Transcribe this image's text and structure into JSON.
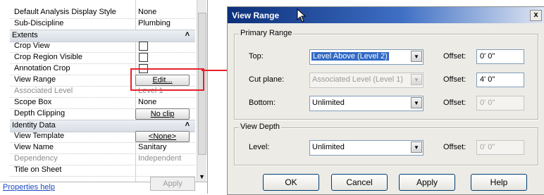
{
  "properties": {
    "rows_top": [
      {
        "label": "Default Analysis Display Style",
        "value": "None"
      },
      {
        "label": "Sub-Discipline",
        "value": "Plumbing"
      }
    ],
    "group_extents": {
      "label": "Extents",
      "collapse_icon": "chevrons-up-icon"
    },
    "extents_rows": [
      {
        "label": "Crop View",
        "checked": false
      },
      {
        "label": "Crop Region Visible",
        "checked": false
      },
      {
        "label": "Annotation Crop",
        "checked": false
      },
      {
        "label": "View Range",
        "button": "Edit..."
      },
      {
        "label": "Associated Level",
        "value": "Level 1",
        "disabled": true
      },
      {
        "label": "Scope Box",
        "value": "None"
      },
      {
        "label": "Depth Clipping",
        "button": "No clip"
      }
    ],
    "group_identity": {
      "label": "Identity Data",
      "collapse_icon": "chevrons-up-icon"
    },
    "identity_rows": [
      {
        "label": "View Template",
        "button": "<None>"
      },
      {
        "label": "View Name",
        "value": "Sanitary"
      },
      {
        "label": "Dependency",
        "value": "Independent",
        "disabled": true
      },
      {
        "label": "Title on Sheet",
        "value": ""
      }
    ],
    "help_link": "Properties help",
    "apply_label": "Apply"
  },
  "callout": {
    "color": "#e8202a"
  },
  "dialog": {
    "title": "View Range",
    "close_label": "x",
    "primary_range": {
      "legend": "Primary Range",
      "rows": [
        {
          "label": "Top:",
          "combo": "Level Above (Level 2)",
          "offset_label": "Offset:",
          "offset": "0'  0\""
        },
        {
          "label": "Cut plane:",
          "combo": "Associated Level (Level 1)",
          "offset_label": "Offset:",
          "offset": "4'  0\""
        },
        {
          "label": "Bottom:",
          "combo": "Unlimited",
          "offset_label": "Offset:",
          "offset": "0'  0\""
        }
      ]
    },
    "view_depth": {
      "legend": "View Depth",
      "label": "Level:",
      "combo": "Unlimited",
      "offset_label": "Offset:",
      "offset": "0'  0\""
    },
    "buttons": {
      "ok": "OK",
      "cancel": "Cancel",
      "apply": "Apply",
      "help": "Help"
    },
    "accent_color": "#0b2f7a"
  }
}
